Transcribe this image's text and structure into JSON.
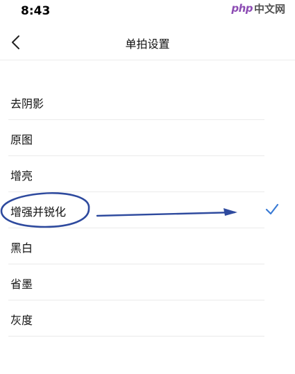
{
  "status_bar": {
    "time": "8:43",
    "watermark_php": "php",
    "watermark_cn": "中文网"
  },
  "nav": {
    "title": "单拍设置",
    "back_icon": "chevron-left-icon"
  },
  "options": [
    {
      "label": "去阴影",
      "selected": false
    },
    {
      "label": "原图",
      "selected": false
    },
    {
      "label": "增亮",
      "selected": false
    },
    {
      "label": "增强并锐化",
      "selected": true
    },
    {
      "label": "黑白",
      "selected": false
    },
    {
      "label": "省墨",
      "selected": false
    },
    {
      "label": "灰度",
      "selected": false
    }
  ],
  "colors": {
    "accent": "#3a7bd5",
    "annotation": "#2e4a9e"
  }
}
